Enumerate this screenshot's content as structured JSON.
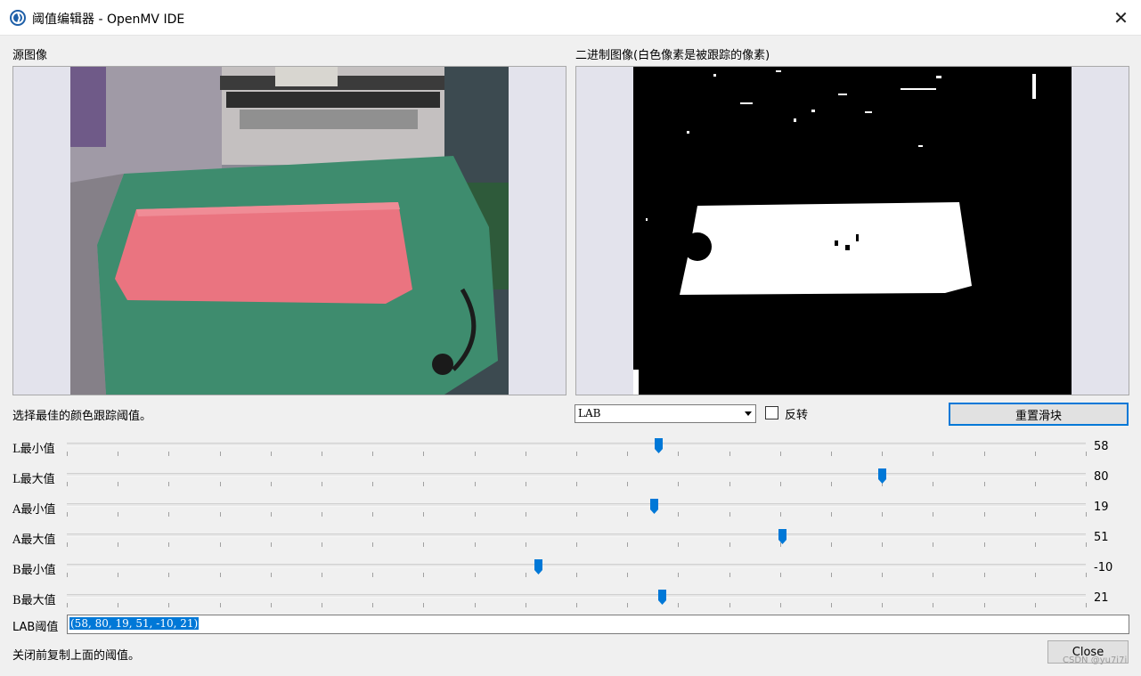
{
  "window": {
    "title": "阈值编辑器 - OpenMV IDE",
    "app_icon": "openmv-logo-icon",
    "close_glyph": "✕"
  },
  "source_panel": {
    "label": "源图像"
  },
  "binary_panel": {
    "label": "二进制图像(白色像素是被跟踪的像素)"
  },
  "hint": "选择最佳的颜色跟踪阈值。",
  "color_space": {
    "selected": "LAB"
  },
  "invert": {
    "label": "反转",
    "checked": false
  },
  "reset_button": {
    "label": "重置滑块"
  },
  "sliders": [
    {
      "prefix": "L",
      "label": "最小值",
      "value": "58",
      "min": 0,
      "max": 100
    },
    {
      "prefix": "L",
      "label": "最大值",
      "value": "80",
      "min": 0,
      "max": 100
    },
    {
      "prefix": "A",
      "label": "最小值",
      "value": "19",
      "min": -128,
      "max": 127
    },
    {
      "prefix": "A",
      "label": "最大值",
      "value": "51",
      "min": -128,
      "max": 127
    },
    {
      "prefix": "B",
      "label": "最小值",
      "value": "-10",
      "min": -128,
      "max": 127
    },
    {
      "prefix": "B",
      "label": "最大值",
      "value": "21",
      "min": -128,
      "max": 127
    }
  ],
  "lab_threshold": {
    "label": "LAB阈值",
    "value": "(58, 80, 19, 51, -10, 21)"
  },
  "footer": {
    "text": "关闭前复制上面的阈值。",
    "close_label": "Close"
  },
  "watermark": "CSDN @yu7i7i",
  "colors": {
    "accent": "#0078d7",
    "track": "#e7e7e7",
    "board": "#3d8c6f",
    "box": "#e8707a"
  }
}
